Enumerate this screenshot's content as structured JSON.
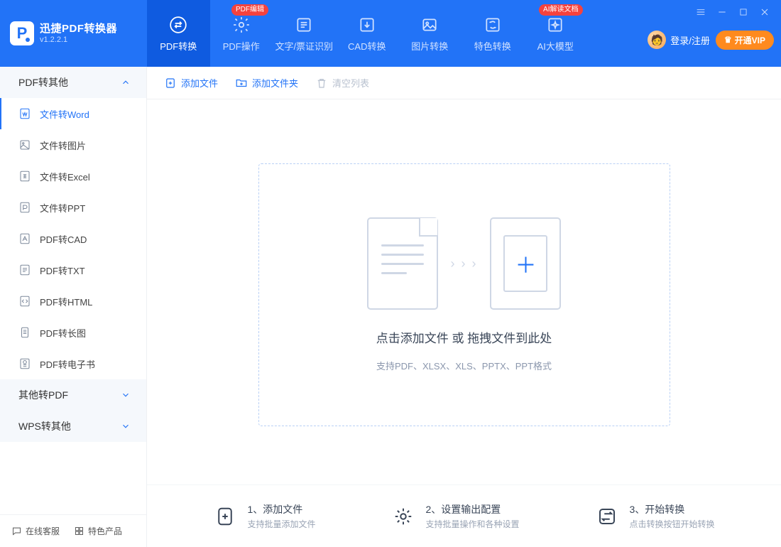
{
  "app": {
    "title": "迅捷PDF转换器",
    "version": "v1.2.2.1"
  },
  "header": {
    "tabs": [
      {
        "label": "PDF转换"
      },
      {
        "label": "PDF操作",
        "badge": "PDF编辑"
      },
      {
        "label": "文字/票证识别"
      },
      {
        "label": "CAD转换"
      },
      {
        "label": "图片转换"
      },
      {
        "label": "特色转换"
      },
      {
        "label": "AI大模型",
        "badge": "AI解读文档"
      }
    ],
    "login": "登录/注册",
    "vip": "开通VIP"
  },
  "sidebar": {
    "groups": [
      {
        "title": "PDF转其他",
        "expanded": true,
        "items": [
          {
            "label": "文件转Word"
          },
          {
            "label": "文件转图片"
          },
          {
            "label": "文件转Excel"
          },
          {
            "label": "文件转PPT"
          },
          {
            "label": "PDF转CAD"
          },
          {
            "label": "PDF转TXT"
          },
          {
            "label": "PDF转HTML"
          },
          {
            "label": "PDF转长图"
          },
          {
            "label": "PDF转电子书"
          }
        ]
      },
      {
        "title": "其他转PDF",
        "expanded": false,
        "items": []
      },
      {
        "title": "WPS转其他",
        "expanded": false,
        "items": []
      }
    ],
    "footer": {
      "support": "在线客服",
      "featured": "特色产品"
    }
  },
  "toolbar": {
    "add_file": "添加文件",
    "add_folder": "添加文件夹",
    "clear_list": "清空列表"
  },
  "dropzone": {
    "title": "点击添加文件 或 拖拽文件到此处",
    "subtitle": "支持PDF、XLSX、XLS、PPTX、PPT格式"
  },
  "steps": [
    {
      "title": "1、添加文件",
      "desc": "支持批量添加文件"
    },
    {
      "title": "2、设置输出配置",
      "desc": "支持批量操作和各种设置"
    },
    {
      "title": "3、开始转换",
      "desc": "点击转换按钮开始转换"
    }
  ]
}
